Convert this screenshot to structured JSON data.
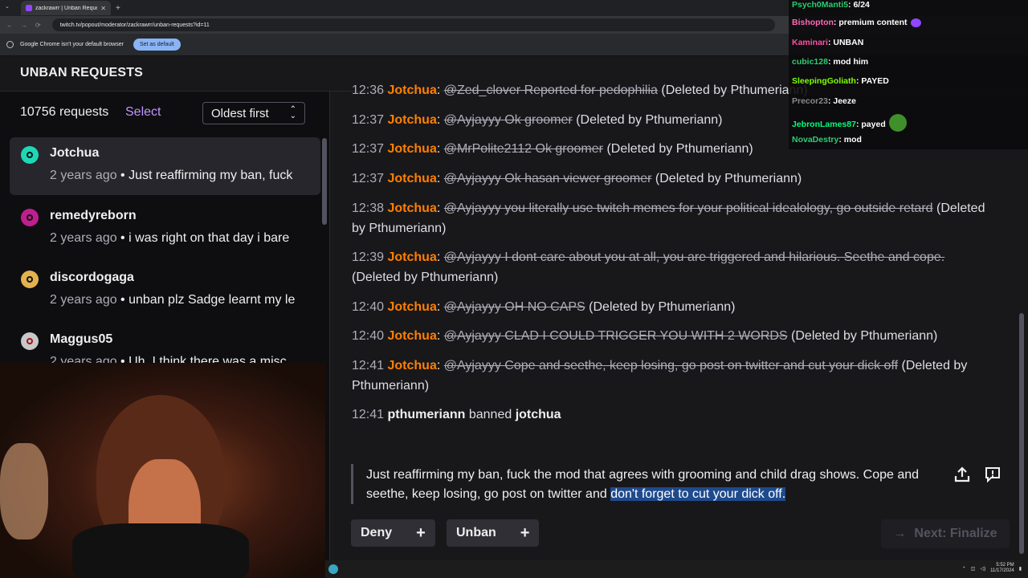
{
  "browser": {
    "tab_title": "zackrawrr | Unban Requests - T",
    "url": "twitch.tv/popout/moderator/zackrawrr/unban-requests?id=11",
    "infobar_text": "Google Chrome isn't your default browser",
    "set_default_label": "Set as default"
  },
  "header": {
    "title": "UNBAN REQUESTS"
  },
  "list": {
    "count": "10756 requests",
    "select_label": "Select",
    "sort_label": "Oldest first",
    "items": [
      {
        "name": "Jotchua",
        "ago": "2 years ago",
        "preview": "Just reaffirming my ban, fuck",
        "avatar_color": "#1ed8b5"
      },
      {
        "name": "remedyreborn",
        "ago": "2 years ago",
        "preview": "i was right on that day i bare",
        "avatar_color": "#c01e8f"
      },
      {
        "name": "discordogaga",
        "ago": "2 years ago",
        "preview": "unban plz Sadge learnt my le",
        "avatar_color": "#e3b24e"
      },
      {
        "name": "Maggus05",
        "ago": "2 years ago",
        "preview": "Uh, I think there was a misc",
        "avatar_color": "#c8c8c8"
      }
    ]
  },
  "log": {
    "lines": [
      {
        "time": "12:36",
        "user": "Jotchua",
        "deleted": "@Zed_clover Reported for pedophilia",
        "note": "(Deleted by Pthumeriann)"
      },
      {
        "time": "12:37",
        "user": "Jotchua",
        "deleted": "@Ayjayyy Ok groomer",
        "note": "(Deleted by Pthumeriann)"
      },
      {
        "time": "12:37",
        "user": "Jotchua",
        "deleted": "@MrPolite2112 Ok groomer",
        "note": "(Deleted by Pthumeriann)"
      },
      {
        "time": "12:37",
        "user": "Jotchua",
        "deleted": "@Ayjayyy Ok hasan viewer groomer",
        "note": "(Deleted by Pthumeriann)"
      },
      {
        "time": "12:38",
        "user": "Jotchua",
        "deleted": "@Ayjayyy you literally use twitch memes for your political idealology, go outside retard",
        "note": "(Deleted by Pthumeriann)"
      },
      {
        "time": "12:39",
        "user": "Jotchua",
        "deleted": "@Ayjayyy I dont care about you at all, you are triggered and hilarious. Seethe and cope.",
        "note": "(Deleted by Pthumeriann)"
      },
      {
        "time": "12:40",
        "user": "Jotchua",
        "deleted": "@Ayjayyy OH NO CAPS",
        "note": "(Deleted by Pthumeriann)"
      },
      {
        "time": "12:40",
        "user": "Jotchua",
        "deleted": "@Ayjayyy CLAD I COULD TRIGGER YOU WITH 2 WORDS",
        "note": "(Deleted by Pthumeriann)"
      },
      {
        "time": "12:41",
        "user": "Jotchua",
        "deleted": "@Ayjayyy Cope and seethe, keep losing, go post on twitter and cut your dick off",
        "note": "(Deleted by Pthumeriann)"
      }
    ],
    "ban": {
      "time": "12:41",
      "moderator": "pthumeriann",
      "action": "banned",
      "target": "jotchua"
    }
  },
  "appeal": {
    "text": "Just reaffirming my ban, fuck the mod that agrees with grooming and child drag shows. Cope and seethe, keep losing, go post on twitter and ",
    "highlighted": "don't forget to cut your dick off."
  },
  "actions": {
    "deny_label": "Deny",
    "unban_label": "Unban",
    "next_label": "Next: Finalize"
  },
  "overlay_chat": [
    {
      "user": "Psych0Manti5",
      "color": "#2ecc71",
      "text": "6/24"
    },
    {
      "user": "Bishopton",
      "color": "#ff69b4",
      "text": "premium content"
    },
    {
      "user": "Kaminari",
      "color": "#ff4fa3",
      "text": "UNBAN"
    },
    {
      "user": "cubic128",
      "color": "#2ecc71",
      "text": "mod him"
    },
    {
      "user": "SleepingGoliath",
      "color": "#7fff00",
      "text": "PAYED"
    },
    {
      "user": "Precor23",
      "color": "#8a8a8a",
      "text": "Jeeze"
    },
    {
      "user": "JebronLames87",
      "color": "#00ff7f",
      "text": "payed"
    },
    {
      "user": "NovaDestry",
      "color": "#2ecc71",
      "text": "mod"
    }
  ],
  "taskbar": {
    "time": "5:52 PM",
    "date": "11/17/2024"
  }
}
